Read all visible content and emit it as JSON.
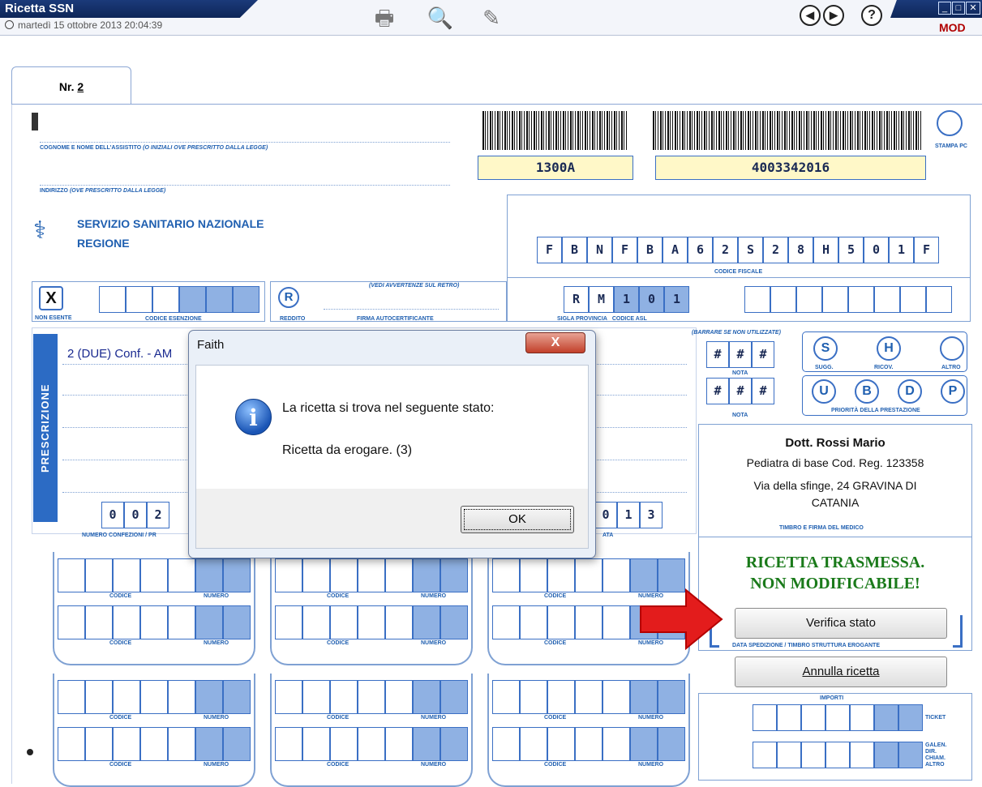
{
  "window": {
    "title": "Ricetta SSN",
    "datetime": "martedì 15 ottobre 2013   20:04:39",
    "mode": "MOD"
  },
  "tabs": [
    {
      "label_prefix": "Nr. ",
      "label_num": "2"
    }
  ],
  "form": {
    "assistito_label": "COGNOME E NOME DELL'ASSISTITO",
    "assistito_note": "(O INIZIALI OVE PRESCRITTO DALLA LEGGE)",
    "indirizzo_label": "INDIRIZZO",
    "indirizzo_note": "(OVE PRESCRITTO DALLA LEGGE)",
    "ssn_line1": "SERVIZIO SANITARIO NAZIONALE",
    "ssn_line2": "REGIONE",
    "barcode1_value": "1300A",
    "barcode2_value": "4003342016",
    "stampa_pc_label": "STAMPA PC",
    "codice_fiscale_chars": [
      "F",
      "B",
      "N",
      "F",
      "B",
      "A",
      "6",
      "2",
      "S",
      "2",
      "8",
      "H",
      "5",
      "0",
      "1",
      "F"
    ],
    "codice_fiscale_label": "CODICE FISCALE",
    "non_esente_label": "NON ESENTE",
    "non_esente_mark": "X",
    "codice_esenzione_label": "CODICE ESENZIONE",
    "reddito_mark": "R",
    "reddito_label": "REDDITO",
    "vedi_avvertenze": "(Vedi avvertenze sul retro)",
    "firma_autocert_label": "FIRMA AUTOCERTIFICANTE",
    "provincia_chars": [
      "R",
      "M"
    ],
    "asl_chars": [
      "1",
      "0",
      "1"
    ],
    "sigla_provincia_label": "SIGLA PROVINCIA",
    "codice_asl_label": "CODICE ASL",
    "barrare_note": "(Barrare se non utilizzate)",
    "nota1_chars": [
      "#",
      "#",
      "#"
    ],
    "nota2_chars": [
      "#",
      "#",
      "#"
    ],
    "nota_label": "NOTA",
    "circles_row1": [
      {
        "mark": "S",
        "label": "SUGG."
      },
      {
        "mark": "H",
        "label": "RICOV."
      },
      {
        "mark": "",
        "label": "ALTRO"
      }
    ],
    "circles_row2": [
      "U",
      "B",
      "D",
      "P"
    ],
    "priorita_label": "PRIORITÀ DELLA PRESTAZIONE",
    "prescrizione_label": "PRESCRIZIONE",
    "prescrizione_line1": "2 (DUE) Conf. - AM",
    "numero_confezioni_chars": [
      "0",
      "0",
      "2"
    ],
    "numero_confezioni_label": "NUMERO CONFEZIONI / PR",
    "data_chars": [
      "0",
      "1",
      "3"
    ],
    "data_label": "ATA",
    "doctor_name": "Dott. Rossi Mario",
    "doctor_role": "Pediatra di base Cod. Reg. 123358",
    "doctor_addr1": "Via della sfinge, 24 GRAVINA DI",
    "doctor_addr2": "CATANIA",
    "timbro_label": "TIMBRO E FIRMA DEL MEDICO",
    "status_line1": "RICETTA TRASMESSA.",
    "status_line2": "NON MODIFICABILE!",
    "verifica_button": "Verifica stato",
    "data_spedizione_label": "DATA SPEDIZIONE / TIMBRO STRUTTURA EROGANTE",
    "annulla_button": "Annulla ricetta",
    "importi_label": "IMPORTI",
    "ticket_label": "TICKET",
    "galen_label": "GALEN. DIR. CHIAM. ALTRO",
    "codice_label": "CODICE",
    "numero_label": "NUMERO"
  },
  "dialog": {
    "title": "Faith",
    "close_glyph": "X",
    "message1": "La ricetta si trova nel seguente stato:",
    "message2": "Ricetta da erogare. (3)",
    "ok_button": "OK"
  },
  "colors": {
    "form_blue": "#1f5fb0",
    "status_green": "#1a7a1a",
    "arrow_red": "#e31c1c",
    "title_bar": "#0e2658"
  }
}
